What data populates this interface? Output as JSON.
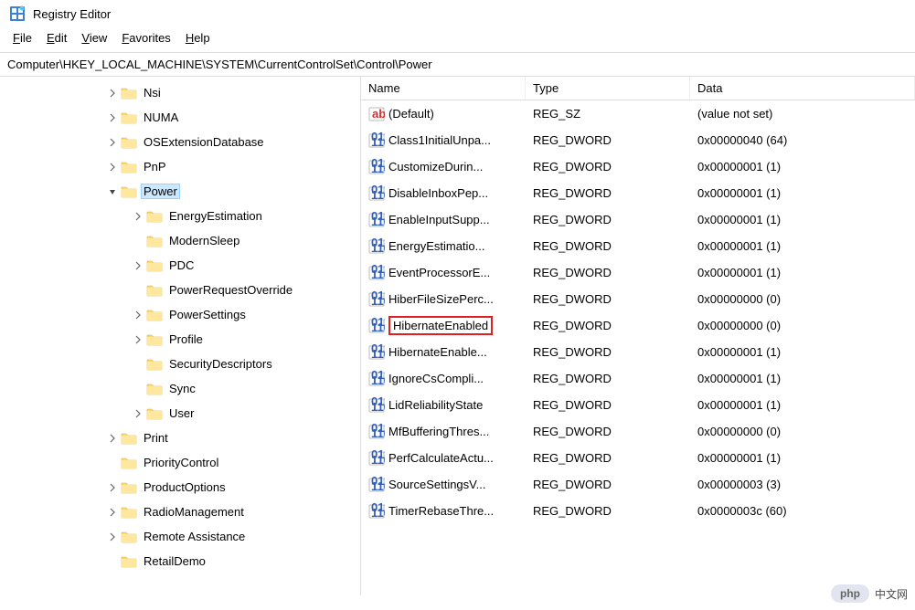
{
  "titlebar": {
    "title": "Registry Editor"
  },
  "menubar": {
    "items": [
      {
        "key": "F",
        "rest": "ile"
      },
      {
        "key": "E",
        "rest": "dit"
      },
      {
        "key": "V",
        "rest": "iew"
      },
      {
        "key": "F",
        "rest": "avorites"
      },
      {
        "key": "H",
        "rest": "elp"
      }
    ]
  },
  "address": "Computer\\HKEY_LOCAL_MACHINE\\SYSTEM\\CurrentControlSet\\Control\\Power",
  "tree": {
    "items": [
      {
        "indent": 116,
        "expander": "›",
        "label": "Nsi"
      },
      {
        "indent": 116,
        "expander": "›",
        "label": "NUMA"
      },
      {
        "indent": 116,
        "expander": "›",
        "label": "OSExtensionDatabase"
      },
      {
        "indent": 116,
        "expander": "›",
        "label": "PnP"
      },
      {
        "indent": 116,
        "expander": "⌄",
        "label": "Power",
        "selected": true
      },
      {
        "indent": 144,
        "expander": "›",
        "label": "EnergyEstimation"
      },
      {
        "indent": 144,
        "expander": "",
        "label": "ModernSleep"
      },
      {
        "indent": 144,
        "expander": "›",
        "label": "PDC"
      },
      {
        "indent": 144,
        "expander": "",
        "label": "PowerRequestOverride"
      },
      {
        "indent": 144,
        "expander": "›",
        "label": "PowerSettings"
      },
      {
        "indent": 144,
        "expander": "›",
        "label": "Profile"
      },
      {
        "indent": 144,
        "expander": "",
        "label": "SecurityDescriptors"
      },
      {
        "indent": 144,
        "expander": "",
        "label": "Sync"
      },
      {
        "indent": 144,
        "expander": "›",
        "label": "User"
      },
      {
        "indent": 116,
        "expander": "›",
        "label": "Print"
      },
      {
        "indent": 116,
        "expander": "",
        "label": "PriorityControl"
      },
      {
        "indent": 116,
        "expander": "›",
        "label": "ProductOptions"
      },
      {
        "indent": 116,
        "expander": "›",
        "label": "RadioManagement"
      },
      {
        "indent": 116,
        "expander": "›",
        "label": "Remote Assistance"
      },
      {
        "indent": 116,
        "expander": "",
        "label": "RetailDemo"
      }
    ]
  },
  "list": {
    "headers": {
      "name": "Name",
      "type": "Type",
      "data": "Data"
    },
    "rows": [
      {
        "icon": "string",
        "name": "(Default)",
        "type": "REG_SZ",
        "data": "(value not set)"
      },
      {
        "icon": "binary",
        "name": "Class1InitialUnpa...",
        "type": "REG_DWORD",
        "data": "0x00000040 (64)"
      },
      {
        "icon": "binary",
        "name": "CustomizeDurin...",
        "type": "REG_DWORD",
        "data": "0x00000001 (1)"
      },
      {
        "icon": "binary",
        "name": "DisableInboxPep...",
        "type": "REG_DWORD",
        "data": "0x00000001 (1)"
      },
      {
        "icon": "binary",
        "name": "EnableInputSupp...",
        "type": "REG_DWORD",
        "data": "0x00000001 (1)"
      },
      {
        "icon": "binary",
        "name": "EnergyEstimatio...",
        "type": "REG_DWORD",
        "data": "0x00000001 (1)"
      },
      {
        "icon": "binary",
        "name": "EventProcessorE...",
        "type": "REG_DWORD",
        "data": "0x00000001 (1)"
      },
      {
        "icon": "binary",
        "name": "HiberFileSizePerc...",
        "type": "REG_DWORD",
        "data": "0x00000000 (0)"
      },
      {
        "icon": "binary",
        "name": "HibernateEnabled",
        "type": "REG_DWORD",
        "data": "0x00000000 (0)",
        "highlighted": true
      },
      {
        "icon": "binary",
        "name": "HibernateEnable...",
        "type": "REG_DWORD",
        "data": "0x00000001 (1)"
      },
      {
        "icon": "binary",
        "name": "IgnoreCsCompli...",
        "type": "REG_DWORD",
        "data": "0x00000001 (1)"
      },
      {
        "icon": "binary",
        "name": "LidReliabilityState",
        "type": "REG_DWORD",
        "data": "0x00000001 (1)"
      },
      {
        "icon": "binary",
        "name": "MfBufferingThres...",
        "type": "REG_DWORD",
        "data": "0x00000000 (0)"
      },
      {
        "icon": "binary",
        "name": "PerfCalculateActu...",
        "type": "REG_DWORD",
        "data": "0x00000001 (1)"
      },
      {
        "icon": "binary",
        "name": "SourceSettingsV...",
        "type": "REG_DWORD",
        "data": "0x00000003 (3)"
      },
      {
        "icon": "binary",
        "name": "TimerRebaseThre...",
        "type": "REG_DWORD",
        "data": "0x0000003c (60)"
      }
    ]
  },
  "watermark": {
    "badge": "php",
    "text": "中文网"
  }
}
